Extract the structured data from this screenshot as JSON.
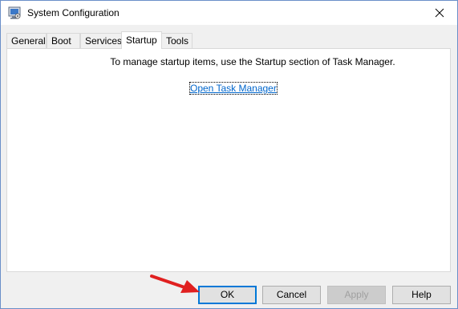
{
  "window": {
    "title": "System Configuration",
    "icon": "msconfig-icon",
    "close_symbol": "close-icon"
  },
  "tabs": [
    {
      "label": "General",
      "active": false
    },
    {
      "label": "Boot",
      "active": false
    },
    {
      "label": "Services",
      "active": false
    },
    {
      "label": "Startup",
      "active": true
    },
    {
      "label": "Tools",
      "active": false
    }
  ],
  "startup_panel": {
    "info_text": "To manage startup items, use the Startup section of Task Manager.",
    "link_text": "Open Task Manager"
  },
  "buttons": {
    "ok": "OK",
    "cancel": "Cancel",
    "apply": "Apply",
    "help": "Help"
  },
  "colors": {
    "accent": "#0078d7",
    "link": "#0066cc",
    "annotation_arrow": "#e02020"
  }
}
